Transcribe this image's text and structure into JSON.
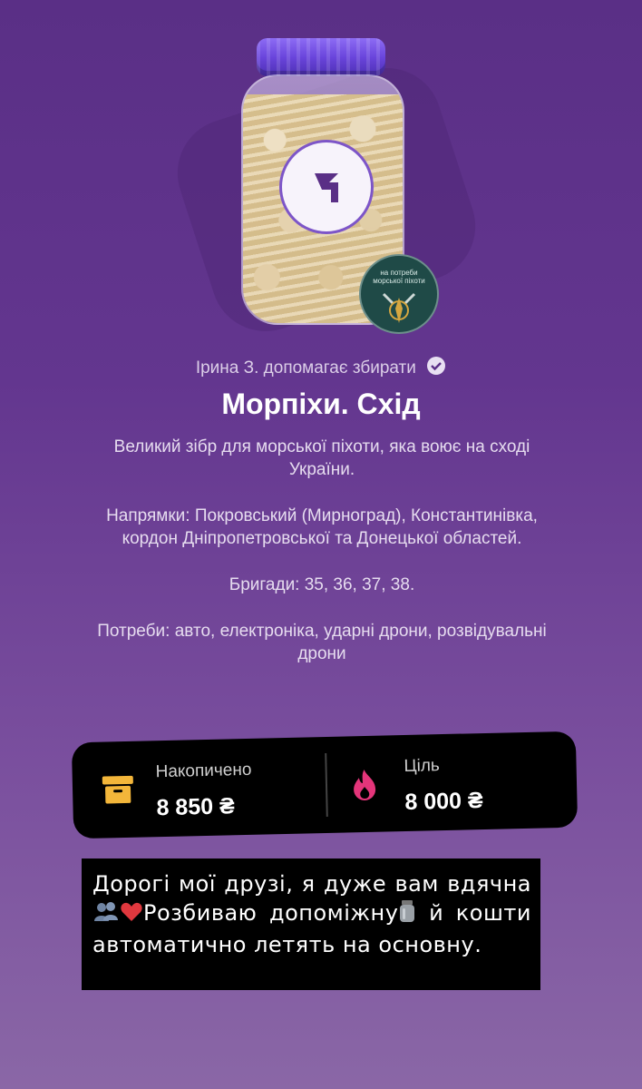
{
  "header": {
    "badge_text": "на потреби морської піхоти"
  },
  "fundraiser": {
    "helper_text": "Ірина З. допомагає збирати",
    "title": "Морпіхи. Схід",
    "description": [
      "Великий зібр для морської піхоти, яка воює на сході України.",
      "Напрямки: Покровський (Мирноград), Константинівка, кордон Дніпропетровської та Донецької областей.",
      "Бригади: 35, 36, 37, 38.",
      "Потреби: авто, електроніка, ударні дрони, розвідувальні дрони"
    ]
  },
  "stats": {
    "accumulated_label": "Накопичено",
    "accumulated_value": "8 850 ₴",
    "goal_label": "Ціль",
    "goal_value": "8 000 ₴"
  },
  "caption": {
    "part1": "Дорогі мої друзі, я дуже вам вдячна",
    "part2": "Розбиваю допоміжну",
    "part3": "й кошти автоматично летять на основну."
  },
  "colors": {
    "accent_purple": "#6a45dc",
    "box_icon": "#f3b63a",
    "fire_icon": "#e4357a"
  }
}
